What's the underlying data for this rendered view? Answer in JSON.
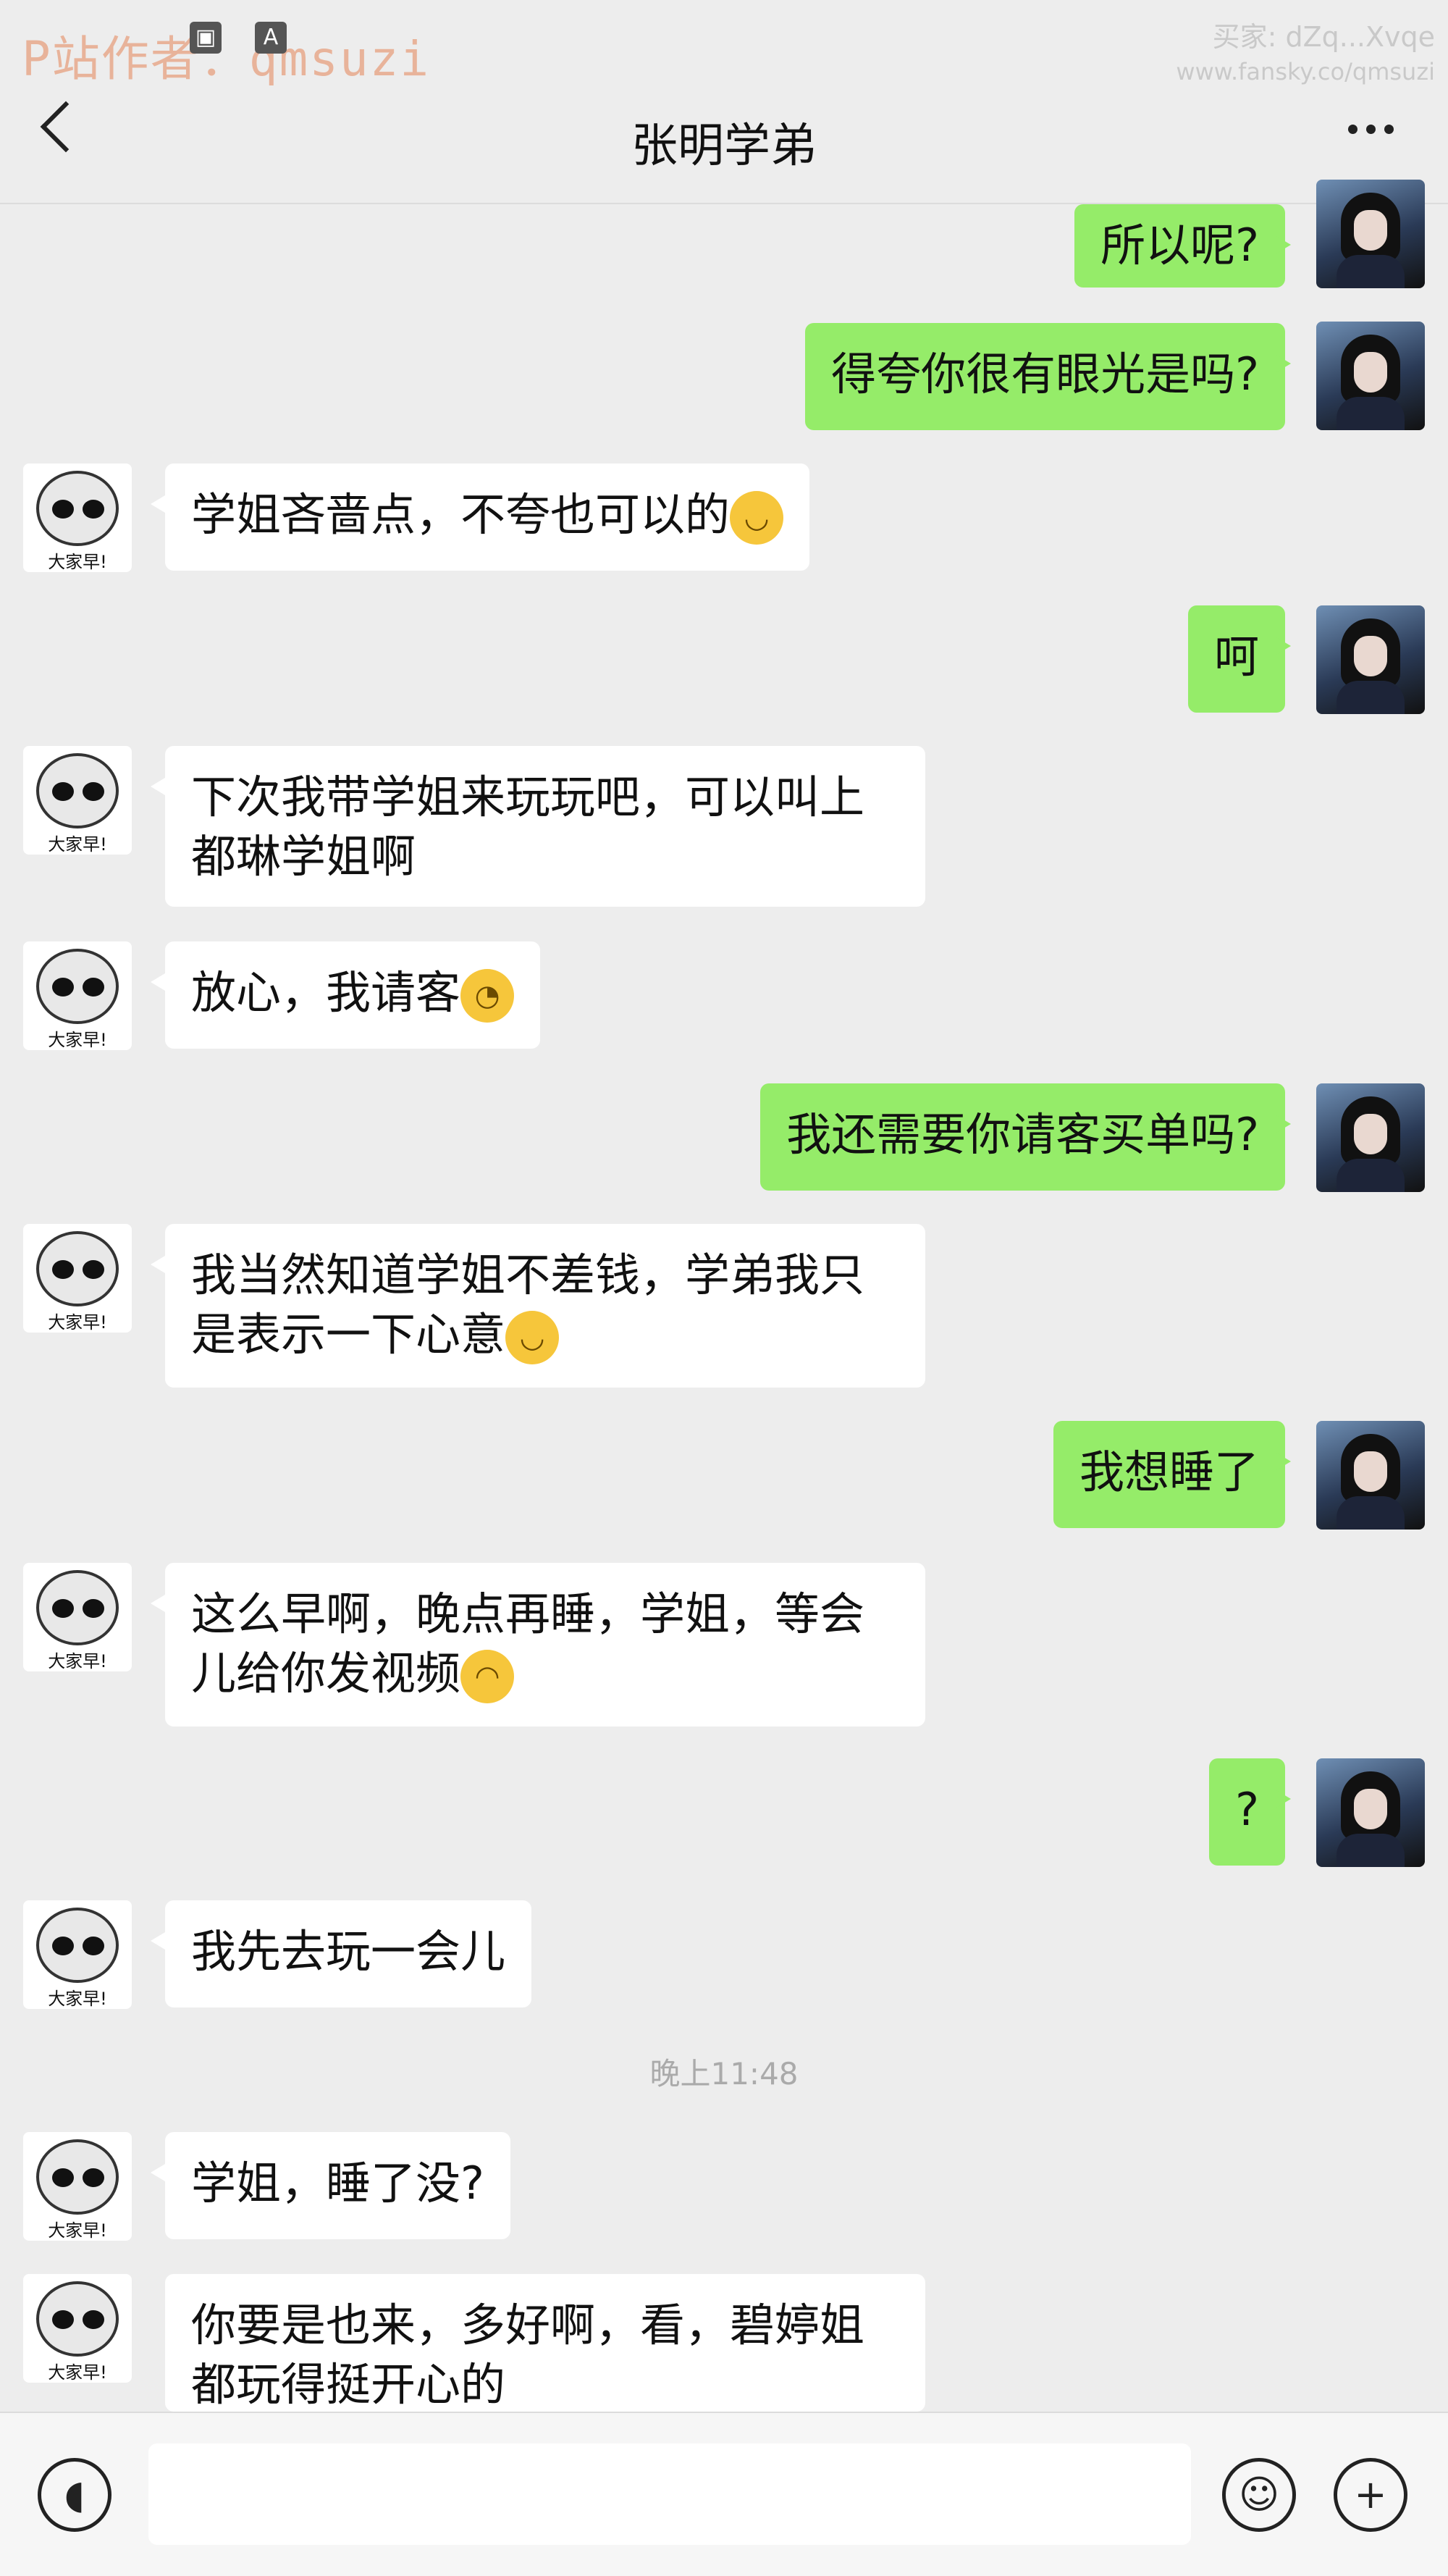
{
  "watermark": {
    "author": "P站作者：qmsuzi",
    "buyer": "买家: dZq...Xvqe",
    "url": "www.fansky.co/qmsuzi"
  },
  "header": {
    "title": "张明学弟"
  },
  "time_divider": "晚上11:48",
  "messages": [
    {
      "from": "me",
      "text": "所以呢?"
    },
    {
      "from": "me",
      "text": "得夸你很有眼光是吗?"
    },
    {
      "from": "other",
      "text": "学姐吝啬点，不夸也可以的",
      "emoji": "grin"
    },
    {
      "from": "me",
      "text": "呵"
    },
    {
      "from": "other",
      "text": "下次我带学姐来玩玩吧，可以叫上都琳学姐啊"
    },
    {
      "from": "other",
      "text": "放心，我请客",
      "emoji": "shy"
    },
    {
      "from": "me",
      "text": "我还需要你请客买单吗?"
    },
    {
      "from": "other",
      "text": "我当然知道学姐不差钱，学弟我只是表示一下心意",
      "emoji": "grin"
    },
    {
      "from": "me",
      "text": "我想睡了"
    },
    {
      "from": "other",
      "text": "这么早啊，晚点再睡，学姐，等会儿给你发视频",
      "emoji": "smirk"
    },
    {
      "from": "me",
      "text": "?"
    },
    {
      "from": "other",
      "text": "我先去玩一会儿"
    },
    {
      "from": "other",
      "text": "学姐，睡了没?"
    },
    {
      "from": "other",
      "text": "你要是也来，多好啊，看，碧婷姐都玩得挺开心的"
    }
  ],
  "avatar_caption": "大家早!",
  "inputbar": {
    "voice_icon": "voice-icon",
    "emoji_icon": "emoji-icon",
    "plus_icon": "plus-icon"
  },
  "colors": {
    "me_bubble": "#95ec69",
    "other_bubble": "#ffffff",
    "background": "#ededed"
  }
}
